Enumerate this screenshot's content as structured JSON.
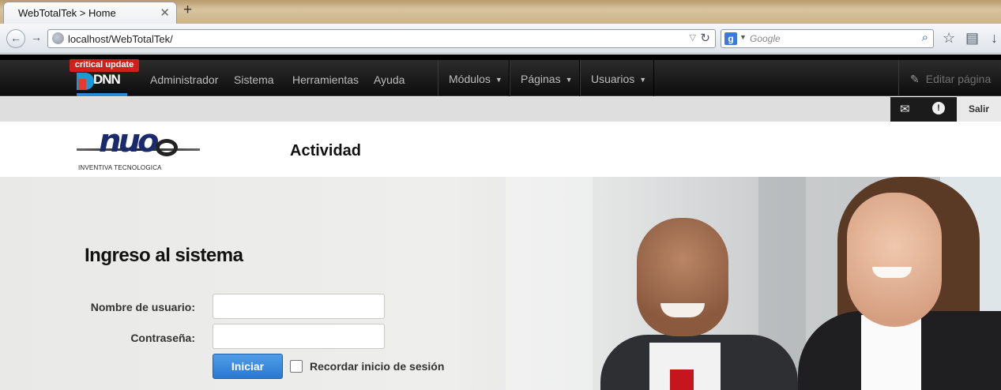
{
  "browser": {
    "tab_title": "WebTotalTek > Home",
    "tab_close": "✕",
    "new_tab": "+",
    "url": "localhost/WebTotalTek/",
    "search_placeholder": "Google",
    "search_engine_letter": "g"
  },
  "controlbar": {
    "critical_badge": "critical update",
    "logo_text": "DNN",
    "links": [
      "Administrador",
      "Sistema",
      "Herramientas",
      "Ayuda"
    ],
    "menus": [
      "Módulos",
      "Páginas",
      "Usuarios"
    ],
    "edit_page": "Editar página"
  },
  "userbar": {
    "logout": "Salir",
    "notification_count": "!"
  },
  "site": {
    "logo_text": "nuo",
    "logo_tagline": "INVENTIVA TECNOLOGICA",
    "page_title": "Actividad"
  },
  "login": {
    "title": "Ingreso al sistema",
    "username_label": "Nombre de usuario:",
    "username_value": "",
    "password_label": "Contraseña:",
    "password_value": "",
    "submit_label": "Iniciar",
    "remember_label": "Recordar inicio de sesión",
    "remember_checked": false
  },
  "colors": {
    "controlbar_bg": "#1a1a1a",
    "accent_blue": "#2a78d2",
    "critical_red": "#d0201e"
  }
}
